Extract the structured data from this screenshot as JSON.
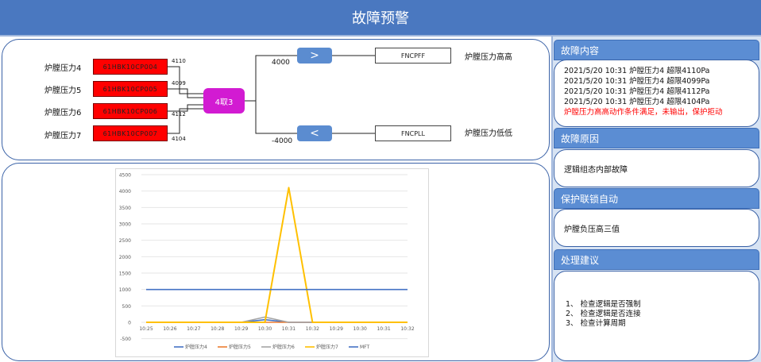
{
  "header": {
    "title": "故障预警"
  },
  "diagram": {
    "inputs": [
      {
        "name": "炉膛压力4",
        "tag": "61HBK10CP004",
        "value": "4110"
      },
      {
        "name": "炉膛压力5",
        "tag": "61HBK10CP005",
        "value": "4099"
      },
      {
        "name": "炉膛压力6",
        "tag": "61HBK10CP006",
        "value": "4112"
      },
      {
        "name": "炉膛压力7",
        "tag": "61HBK10CP007",
        "value": "4104"
      }
    ],
    "vote_label": "4取3",
    "high": {
      "threshold": "4000",
      "op": ">",
      "output": "FNCPFF",
      "label": "炉膛压力高高"
    },
    "low": {
      "threshold": "-4000",
      "op": "<",
      "output": "FNCPLL",
      "label": "炉膛压力低低"
    }
  },
  "chart_data": {
    "type": "line",
    "x": [
      "10:25",
      "10:26",
      "10:27",
      "10:28",
      "10:29",
      "10:30",
      "10:31",
      "10:32",
      "10:29",
      "10:30",
      "10:31",
      "10:32"
    ],
    "y_ticks": [
      "-500",
      "0",
      "500",
      "1000",
      "1500",
      "2000",
      "2500",
      "3000",
      "3500",
      "4000",
      "4500"
    ],
    "ylim": [
      -500,
      4500
    ],
    "series": [
      {
        "name": "炉膛压力4",
        "color": "#4472c4",
        "values": [
          0,
          0,
          0,
          0,
          0,
          80,
          0,
          0,
          0,
          0,
          0,
          0
        ]
      },
      {
        "name": "炉膛压力5",
        "color": "#ed7d31",
        "values": [
          0,
          0,
          0,
          0,
          0,
          0,
          0,
          0,
          0,
          0,
          0,
          0
        ]
      },
      {
        "name": "炉膛压力6",
        "color": "#a5a5a5",
        "values": [
          0,
          0,
          0,
          0,
          0,
          160,
          0,
          0,
          0,
          0,
          0,
          0
        ]
      },
      {
        "name": "炉膛压力7",
        "color": "#ffc000",
        "values": [
          0,
          0,
          0,
          0,
          0,
          0,
          4104,
          0,
          0,
          0,
          0,
          0
        ]
      },
      {
        "name": "MFT",
        "color": "#4472c4",
        "values": [
          1000,
          1000,
          1000,
          1000,
          1000,
          1000,
          1000,
          1000,
          1000,
          1000,
          1000,
          1000
        ]
      }
    ]
  },
  "sections": {
    "content": {
      "title": "故障内容",
      "lines": [
        "2021/5/20 10:31 炉膛压力4  超限4110Pa",
        "2021/5/20 10:31 炉膛压力4  超限4099Pa",
        "2021/5/20 10:31 炉膛压力4  超限4112Pa",
        "2021/5/20 10:31 炉膛压力4  超限4104Pa"
      ],
      "alarm": "炉膛压力高高动作条件满足，未输出，保护拒动"
    },
    "cause": {
      "title": "故障原因",
      "text": "逻辑组态内部故障"
    },
    "interlock": {
      "title": "保护联锁自动",
      "text": "炉膛负压高三值"
    },
    "advice": {
      "title": "处理建议",
      "items": [
        "1、 检查逻辑是否强制",
        "2、 检查逻辑是否连接",
        "3、 检查计算周期"
      ]
    }
  }
}
